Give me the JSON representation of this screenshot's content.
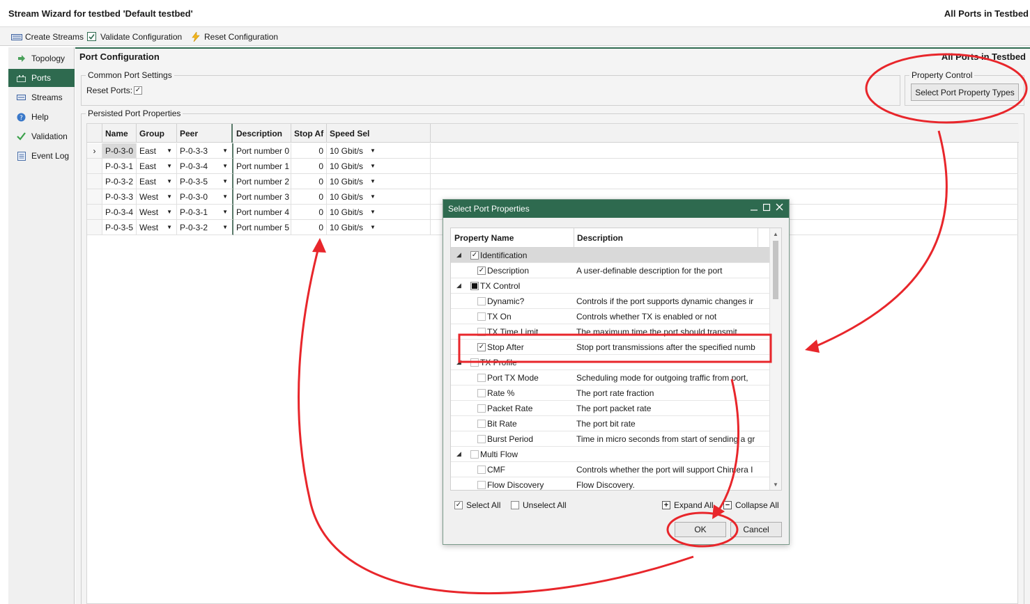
{
  "window": {
    "title": "Stream Wizard for testbed 'Default testbed'",
    "right_title": "All Ports in Testbed"
  },
  "toolbar": {
    "create_streams": "Create Streams",
    "validate_configuration": "Validate Configuration",
    "reset_configuration": "Reset Configuration"
  },
  "sidebar": {
    "items": [
      {
        "label": "Topology",
        "icon": "arrow-right-icon"
      },
      {
        "label": "Ports",
        "icon": "port-icon"
      },
      {
        "label": "Streams",
        "icon": "streams-icon"
      },
      {
        "label": "Help",
        "icon": "help-icon"
      },
      {
        "label": "Validation",
        "icon": "check-icon"
      },
      {
        "label": "Event Log",
        "icon": "log-icon"
      }
    ],
    "active": "Ports"
  },
  "main": {
    "header": "Port Configuration",
    "header_right": "All Ports in Testbed",
    "common_settings": {
      "legend": "Common Port Settings",
      "reset_ports_label": "Reset Ports:",
      "reset_ports_checked": true
    },
    "property_control": {
      "legend": "Property Control",
      "button": "Select Port Property Types"
    },
    "persisted": {
      "legend": "Persisted Port Properties",
      "columns": [
        "Name",
        "Group",
        "Peer",
        "Description",
        "Stop Af",
        "Speed Sel"
      ],
      "rows": [
        {
          "name": "P-0-3-0",
          "group": "East",
          "peer": "P-0-3-3",
          "description": "Port number 0",
          "stop_after": "0",
          "speed": "10 Gbit/s"
        },
        {
          "name": "P-0-3-1",
          "group": "East",
          "peer": "P-0-3-4",
          "description": "Port number 1",
          "stop_after": "0",
          "speed": "10 Gbit/s"
        },
        {
          "name": "P-0-3-2",
          "group": "East",
          "peer": "P-0-3-5",
          "description": "Port number 2",
          "stop_after": "0",
          "speed": "10 Gbit/s"
        },
        {
          "name": "P-0-3-3",
          "group": "West",
          "peer": "P-0-3-0",
          "description": "Port number 3",
          "stop_after": "0",
          "speed": "10 Gbit/s"
        },
        {
          "name": "P-0-3-4",
          "group": "West",
          "peer": "P-0-3-1",
          "description": "Port number 4",
          "stop_after": "0",
          "speed": "10 Gbit/s"
        },
        {
          "name": "P-0-3-5",
          "group": "West",
          "peer": "P-0-3-2",
          "description": "Port number 5",
          "stop_after": "0",
          "speed": "10 Gbit/s"
        }
      ]
    }
  },
  "dialog": {
    "title": "Select Port Properties",
    "columns": [
      "Property Name",
      "Description"
    ],
    "rows": [
      {
        "level": 0,
        "expander": true,
        "check": "on",
        "name": "Identification",
        "description": "",
        "selected": true
      },
      {
        "level": 1,
        "check": "on",
        "name": "Description",
        "description": "A user-definable description for the port"
      },
      {
        "level": 0,
        "expander": true,
        "check": "partial",
        "name": "TX Control",
        "description": ""
      },
      {
        "level": 1,
        "check": "off",
        "name": "Dynamic?",
        "description": "Controls if the port supports dynamic changes ir"
      },
      {
        "level": 1,
        "check": "off",
        "name": "TX On",
        "description": "Controls whether TX is enabled or not"
      },
      {
        "level": 1,
        "check": "off",
        "name": "TX Time Limit",
        "description": "The maximum time the port should transmit"
      },
      {
        "level": 1,
        "check": "on",
        "name": "Stop After",
        "description": "Stop port transmissions after the specified numb"
      },
      {
        "level": 0,
        "expander": true,
        "check": "off",
        "name": "TX Profile",
        "description": ""
      },
      {
        "level": 1,
        "check": "off",
        "name": "Port TX Mode",
        "description": "Scheduling mode for outgoing traffic from port,"
      },
      {
        "level": 1,
        "check": "off",
        "name": "Rate %",
        "description": "The port rate fraction"
      },
      {
        "level": 1,
        "check": "off",
        "name": "Packet Rate",
        "description": "The port packet rate"
      },
      {
        "level": 1,
        "check": "off",
        "name": "Bit Rate",
        "description": "The port bit rate"
      },
      {
        "level": 1,
        "check": "off",
        "name": "Burst Period",
        "description": "Time in micro seconds from start of sending a gr"
      },
      {
        "level": 0,
        "expander": true,
        "check": "off",
        "name": "Multi Flow",
        "description": ""
      },
      {
        "level": 1,
        "check": "off",
        "name": "CMF",
        "description": "Controls whether the port will support Chimera I"
      },
      {
        "level": 1,
        "check": "off",
        "name": "Flow Discovery",
        "description": "Flow Discovery."
      }
    ],
    "select_all": "Select All",
    "unselect_all": "Unselect All",
    "expand_all": "Expand All",
    "collapse_all": "Collapse All",
    "ok": "OK",
    "cancel": "Cancel"
  },
  "annotation_color": "#e8262b",
  "accent_color": "#2e6a4f"
}
